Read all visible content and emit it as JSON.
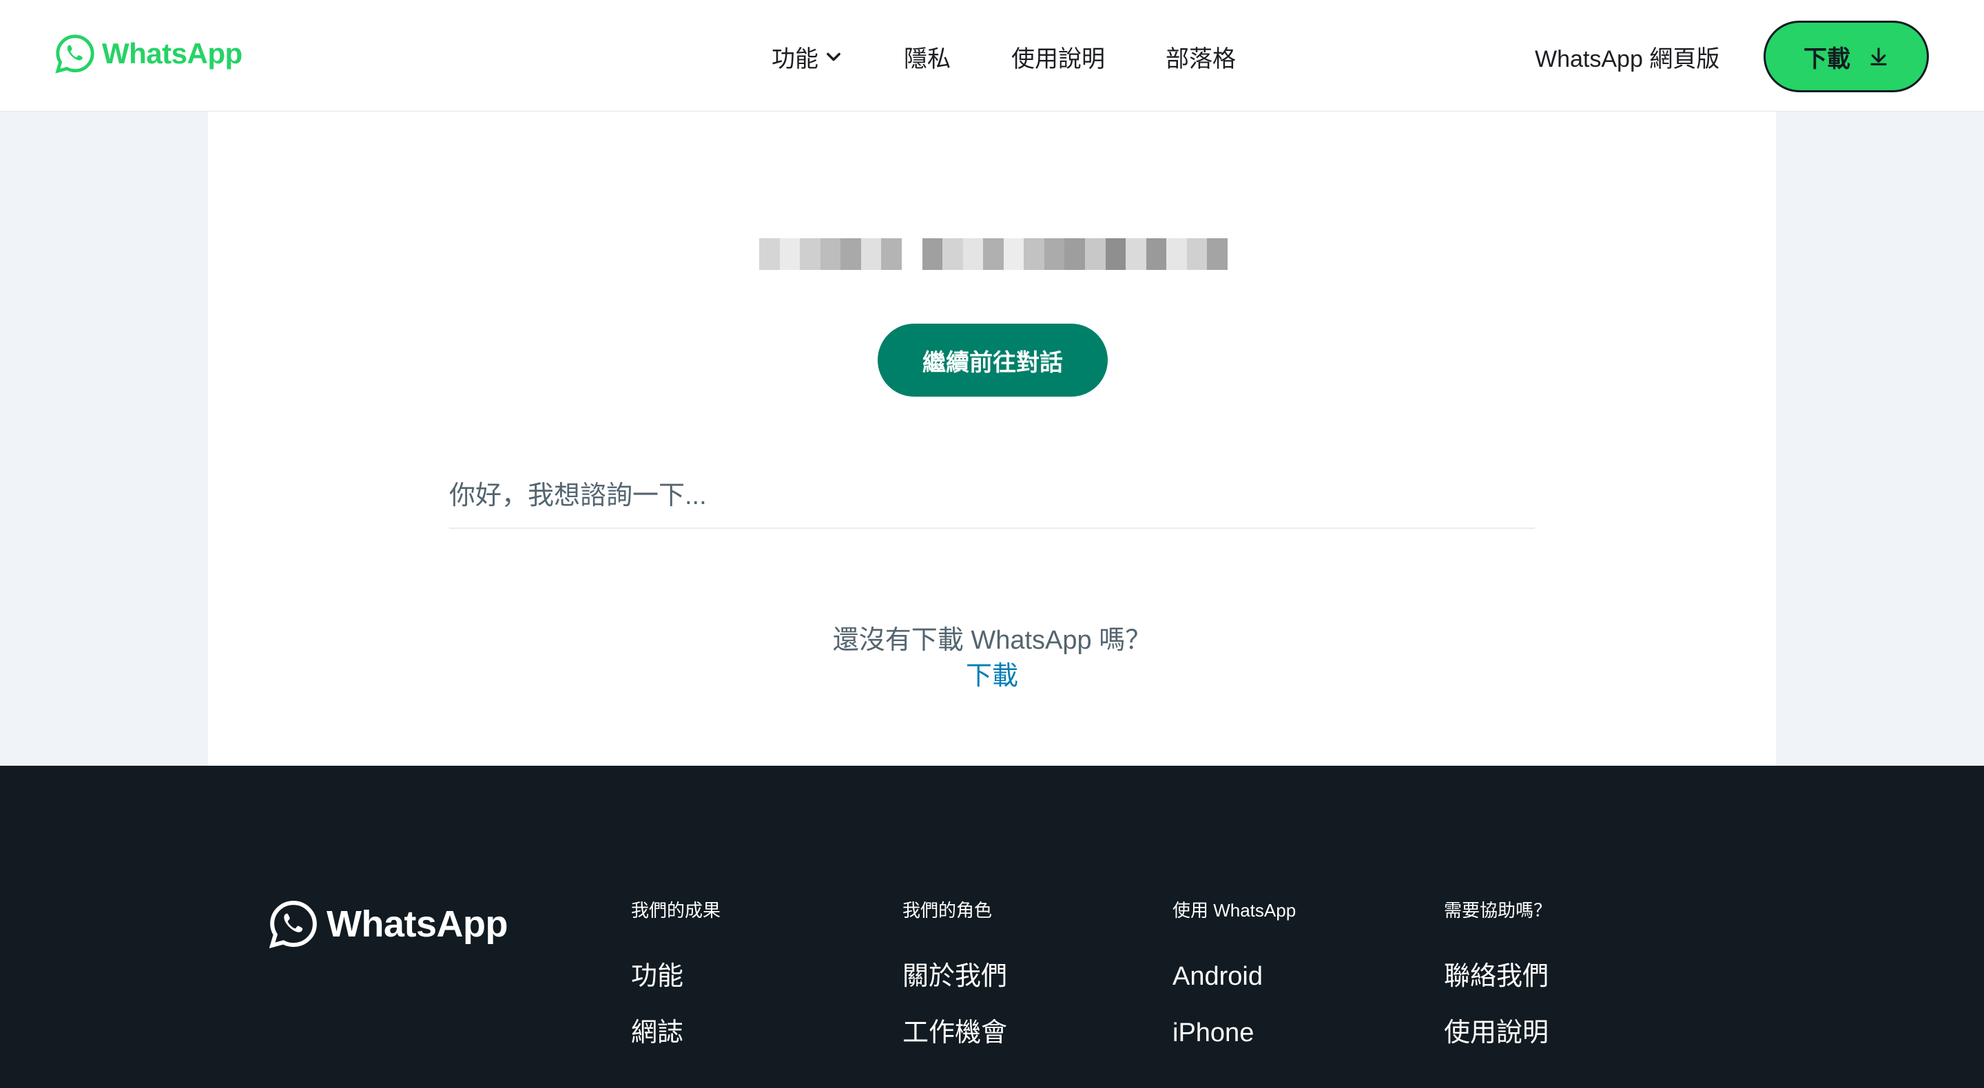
{
  "brand": {
    "name": "WhatsApp",
    "color": "#25d366"
  },
  "header": {
    "nav": [
      {
        "label": "功能",
        "has_dropdown": true
      },
      {
        "label": "隱私"
      },
      {
        "label": "使用說明"
      },
      {
        "label": "部落格"
      }
    ],
    "web_link": "WhatsApp 網頁版",
    "download_label": "下載"
  },
  "main": {
    "continue_label": "繼續前往對話",
    "message_preview": "你好，我想諮詢一下...",
    "no_app_prompt": "還沒有下載 WhatsApp 嗎？",
    "download_link": "下載"
  },
  "footer": {
    "columns": [
      {
        "heading": "我們的成果",
        "items": [
          "功能",
          "網誌"
        ]
      },
      {
        "heading": "我們的角色",
        "items": [
          "關於我們",
          "工作機會"
        ]
      },
      {
        "heading": "使用 WhatsApp",
        "items": [
          "Android",
          "iPhone"
        ]
      },
      {
        "heading": "需要協助嗎？",
        "items": [
          "聯絡我們",
          "使用說明"
        ]
      }
    ]
  },
  "colors": {
    "accent_green": "#25d366",
    "button_teal": "#008069",
    "link_blue": "#027eb5",
    "footer_bg": "#111b21",
    "page_bg": "#f0f4f8"
  }
}
